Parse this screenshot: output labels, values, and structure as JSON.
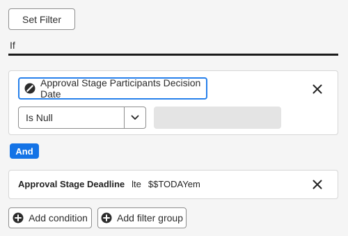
{
  "toolbar": {
    "set_filter_label": "Set Filter"
  },
  "if_label": "If",
  "group": {
    "condition1": {
      "field_label": "Approval Stage Participants Decision Date",
      "field_icon": "no-entry-icon",
      "operator_selected": "Is Null"
    },
    "connector_label": "And",
    "condition2": {
      "field_label": "Approval Stage Deadline",
      "operator": "lte",
      "value": "$$TODAYem"
    }
  },
  "actions": {
    "add_condition_label": "Add condition",
    "add_filter_group_label": "Add filter group"
  },
  "colors": {
    "accent": "#1473e6",
    "focus_border": "#2680eb",
    "background": "#f5f5f5"
  }
}
